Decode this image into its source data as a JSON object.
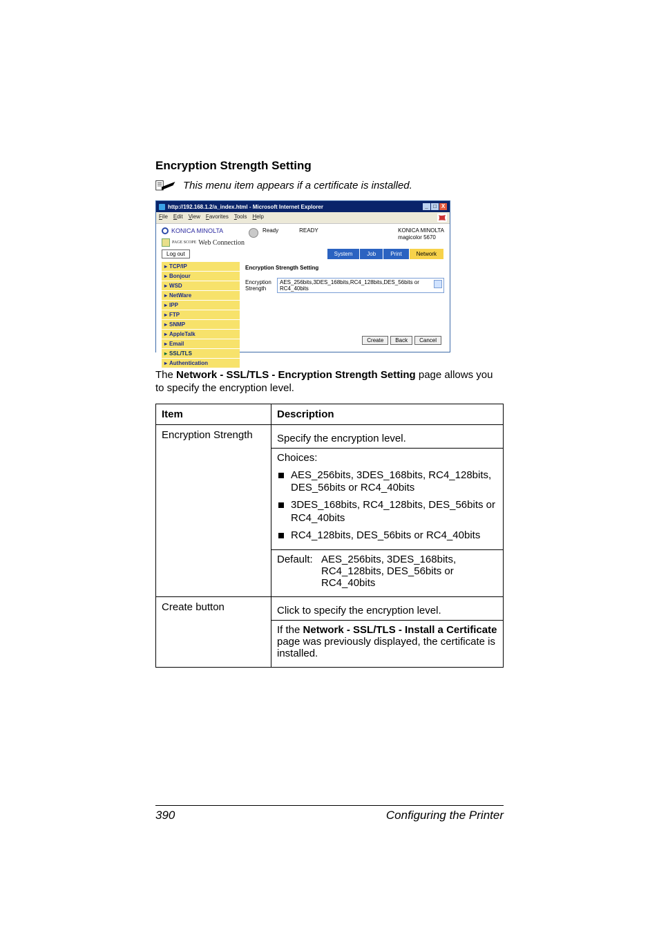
{
  "section_title": "Encryption Strength Setting",
  "note": "This menu item appears if a certificate is installed.",
  "browser": {
    "title": "http://192.168.1.2/a_index.html - Microsoft Internet Explorer",
    "menus": [
      "File",
      "Edit",
      "View",
      "Favorites",
      "Tools",
      "Help"
    ],
    "brand": "KONICA MINOLTA",
    "webconn_prefix": "PAGE SCOPE",
    "webconn": "Web Connection",
    "status_ready": "Ready",
    "status_big": "READY",
    "device_brand": "KONICA MINOLTA",
    "device_model": "magicolor 5670",
    "logout": "Log out",
    "tabs": [
      "System",
      "Job",
      "Print",
      "Network"
    ],
    "sidebar": [
      "TCP/IP",
      "Bonjour",
      "WSD",
      "NetWare",
      "IPP",
      "FTP",
      "SNMP",
      "AppleTalk",
      "Email",
      "SSL/TLS",
      "Authentication"
    ],
    "content_title": "Encryption Strength Setting",
    "enc_label": "Encryption Strength",
    "enc_value": "AES_256bits,3DES_168bits,RC4_128bits,DES_56bits or RC4_40bits",
    "btn_create": "Create",
    "btn_back": "Back",
    "btn_cancel": "Cancel"
  },
  "paragraph": {
    "before": "The ",
    "bold": "Network - SSL/TLS - Encryption Strength Setting",
    "after": " page allows you to specify the encryption level."
  },
  "table": {
    "head_item": "Item",
    "head_desc": "Description",
    "row1_item": "Encryption Strength",
    "row1_l1": "Specify the encryption level.",
    "row1_l2": "Choices:",
    "row1_b1": "AES_256bits, 3DES_168bits, RC4_128bits, DES_56bits or RC4_40bits",
    "row1_b2": "3DES_168bits, RC4_128bits, DES_56bits or RC4_40bits",
    "row1_b3": "RC4_128bits, DES_56bits or RC4_40bits",
    "row1_def_label": "Default:",
    "row1_def": "AES_256bits, 3DES_168bits, RC4_128bits, DES_56bits or RC4_40bits",
    "row2_item": "Create button",
    "row2_l1": "Click to specify the encryption level.",
    "row2_l2a": "If the ",
    "row2_l2b": "Network - SSL/TLS - Install a Certificate",
    "row2_l2c": " page was previously displayed, the certificate is installed."
  },
  "footer": {
    "page": "390",
    "section": "Configuring the Printer"
  }
}
